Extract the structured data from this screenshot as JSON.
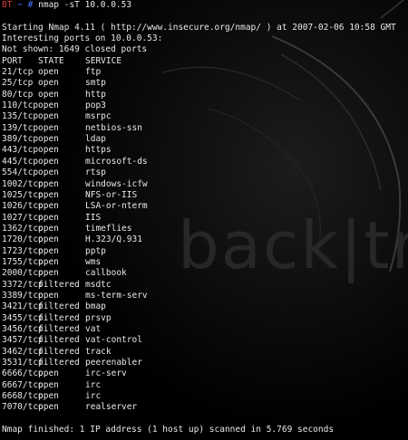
{
  "prompt": {
    "host": "BT",
    "path": "~",
    "symbol": "#",
    "command": "nmap -sT 10.0.0.53"
  },
  "output": {
    "starting": "Starting Nmap 4.11 ( http://www.insecure.org/nmap/ ) at 2007-02-06 10:58 GMT",
    "interesting": "Interesting ports on 10.0.0.53:",
    "not_shown": "Not shown: 1649 closed ports",
    "headers": {
      "port": "PORT",
      "state": "STATE",
      "service": "SERVICE"
    },
    "ports": [
      {
        "port": "21/tcp",
        "state": "open",
        "service": "ftp"
      },
      {
        "port": "25/tcp",
        "state": "open",
        "service": "smtp"
      },
      {
        "port": "80/tcp",
        "state": "open",
        "service": "http"
      },
      {
        "port": "110/tcp",
        "state": "open",
        "service": "pop3"
      },
      {
        "port": "135/tcp",
        "state": "open",
        "service": "msrpc"
      },
      {
        "port": "139/tcp",
        "state": "open",
        "service": "netbios-ssn"
      },
      {
        "port": "389/tcp",
        "state": "open",
        "service": "ldap"
      },
      {
        "port": "443/tcp",
        "state": "open",
        "service": "https"
      },
      {
        "port": "445/tcp",
        "state": "open",
        "service": "microsoft-ds"
      },
      {
        "port": "554/tcp",
        "state": "open",
        "service": "rtsp"
      },
      {
        "port": "1002/tcp",
        "state": "open",
        "service": "windows-icfw"
      },
      {
        "port": "1025/tcp",
        "state": "open",
        "service": "NFS-or-IIS"
      },
      {
        "port": "1026/tcp",
        "state": "open",
        "service": "LSA-or-nterm"
      },
      {
        "port": "1027/tcp",
        "state": "open",
        "service": "IIS"
      },
      {
        "port": "1362/tcp",
        "state": "open",
        "service": "timeflies"
      },
      {
        "port": "1720/tcp",
        "state": "open",
        "service": "H.323/Q.931"
      },
      {
        "port": "1723/tcp",
        "state": "open",
        "service": "pptp"
      },
      {
        "port": "1755/tcp",
        "state": "open",
        "service": "wms"
      },
      {
        "port": "2000/tcp",
        "state": "open",
        "service": "callbook"
      },
      {
        "port": "3372/tcp",
        "state": "filtered",
        "service": "msdtc"
      },
      {
        "port": "3389/tcp",
        "state": "open",
        "service": "ms-term-serv"
      },
      {
        "port": "3421/tcp",
        "state": "filtered",
        "service": "bmap"
      },
      {
        "port": "3455/tcp",
        "state": "filtered",
        "service": "prsvp"
      },
      {
        "port": "3456/tcp",
        "state": "filtered",
        "service": "vat"
      },
      {
        "port": "3457/tcp",
        "state": "filtered",
        "service": "vat-control"
      },
      {
        "port": "3462/tcp",
        "state": "filtered",
        "service": "track"
      },
      {
        "port": "3531/tcp",
        "state": "filtered",
        "service": "peerenabler"
      },
      {
        "port": "6666/tcp",
        "state": "open",
        "service": "irc-serv"
      },
      {
        "port": "6667/tcp",
        "state": "open",
        "service": "irc"
      },
      {
        "port": "6668/tcp",
        "state": "open",
        "service": "irc"
      },
      {
        "port": "7070/tcp",
        "state": "open",
        "service": "realserver"
      }
    ],
    "finished": "Nmap finished: 1 IP address (1 host up) scanned in 5.769 seconds"
  },
  "wallpaper": {
    "logo_text": "back|track"
  },
  "colors": {
    "background": "#000000",
    "text": "#e8e8e8",
    "prompt_host": "#d23a3a",
    "prompt_path": "#4a78ff"
  }
}
